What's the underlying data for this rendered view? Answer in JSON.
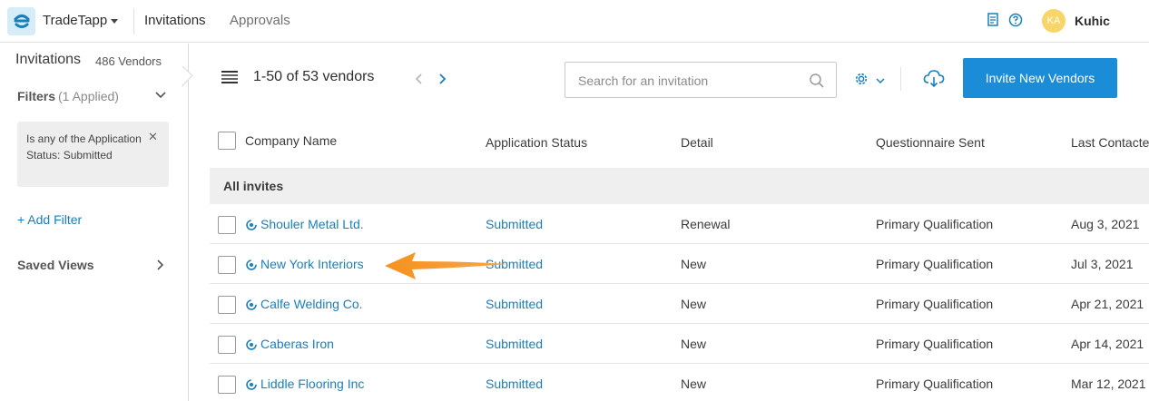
{
  "header": {
    "app_name": "TradeTapp",
    "nav": {
      "invitations": "Invitations",
      "approvals": "Approvals"
    },
    "user": {
      "initials": "KA",
      "name": "Kuhic"
    }
  },
  "sidebar": {
    "title": "Invitations",
    "vendor_count": "486 Vendors",
    "filters_label": "Filters",
    "filters_applied": "(1 Applied)",
    "filter_chip": "Is any of the Application Status: Submitted",
    "add_filter": "+ Add Filter",
    "saved_views": "Saved Views"
  },
  "toolbar": {
    "range": "1-50 of 53 vendors",
    "search_placeholder": "Search for an invitation",
    "invite_label": "Invite New Vendors"
  },
  "table": {
    "columns": [
      "Company Name",
      "Application Status",
      "Detail",
      "Questionnaire Sent",
      "Last Contacted"
    ],
    "group_label": "All invites",
    "rows": [
      {
        "company": "Shouler Metal Ltd.",
        "status": "Submitted",
        "detail": "Renewal",
        "questionnaire": "Primary Qualification",
        "last_contacted": "Aug 3, 2021"
      },
      {
        "company": "New York Interiors",
        "status": "Submitted",
        "detail": "New",
        "questionnaire": "Primary Qualification",
        "last_contacted": "Jul 3, 2021"
      },
      {
        "company": "Calfe Welding Co.",
        "status": "Submitted",
        "detail": "New",
        "questionnaire": "Primary Qualification",
        "last_contacted": "Apr 21, 2021"
      },
      {
        "company": "Caberas Iron",
        "status": "Submitted",
        "detail": "New",
        "questionnaire": "Primary Qualification",
        "last_contacted": "Apr 14, 2021"
      },
      {
        "company": "Liddle Flooring Inc",
        "status": "Submitted",
        "detail": "New",
        "questionnaire": "Primary Qualification",
        "last_contacted": "Mar 12, 2021"
      }
    ]
  },
  "icons": {
    "logo": "tradetapp-logo-icon",
    "doc": "document-icon",
    "help": "help-icon",
    "search": "search-icon",
    "settings": "gear-icon",
    "download": "cloud-download-icon",
    "menu": "hamburger-icon",
    "vendor": "vendor-status-icon"
  },
  "colors": {
    "accent": "#1a8cd8",
    "link": "#1a7fbc",
    "annotation_arrow": "#f5921e",
    "avatar": "#f7d568"
  }
}
